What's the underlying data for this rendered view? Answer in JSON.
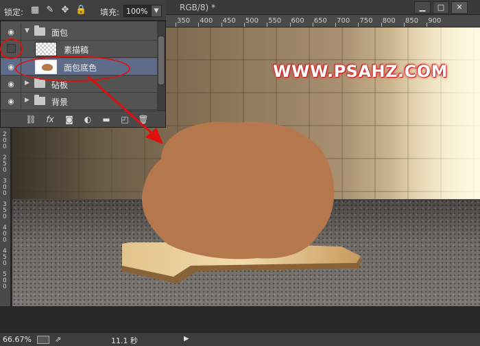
{
  "window": {
    "doc_title": "RGB/8) *",
    "min_label": "▁",
    "max_label": "□",
    "close_label": "✕"
  },
  "options_bar": {
    "lock_label": "锁定:",
    "fill_label": "填充:",
    "fill_value": "100%",
    "lock_icons": [
      "transparency-lock-icon",
      "brush-icon",
      "move-icon",
      "padlock-icon"
    ]
  },
  "ruler": {
    "top_ticks": [
      "350",
      "400",
      "450",
      "500",
      "550",
      "600",
      "650",
      "700",
      "750",
      "800",
      "850",
      "900"
    ],
    "left_ticks": [
      "2\n0\n0",
      "2\n5\n0",
      "3\n0\n0",
      "3\n5\n0",
      "4\n0\n0",
      "4\n5\n0",
      "5\n0\n0"
    ]
  },
  "layers": {
    "rows": [
      {
        "name": "面包",
        "kind": "group",
        "expanded": true,
        "visible": true
      },
      {
        "name": "素描稿",
        "kind": "layer",
        "visible": false
      },
      {
        "name": "面包底色",
        "kind": "layer",
        "visible": true,
        "selected": true
      },
      {
        "name": "砧板",
        "kind": "group",
        "expanded": false,
        "visible": true
      },
      {
        "name": "背景",
        "kind": "group",
        "expanded": false,
        "visible": true
      }
    ],
    "footer_icons": [
      "link-icon",
      "fx-icon",
      "mask-icon",
      "adjustment-icon",
      "folder-icon",
      "new-layer-icon",
      "trash-icon"
    ]
  },
  "canvas": {
    "watermark": "WWW.PSAHZ.COM"
  },
  "status": {
    "zoom": "66.67%",
    "timing": "11.1 秒"
  },
  "colors": {
    "bread": "#b5784d",
    "annotation": "#e01010",
    "selected_row": "#5e6c8a"
  }
}
